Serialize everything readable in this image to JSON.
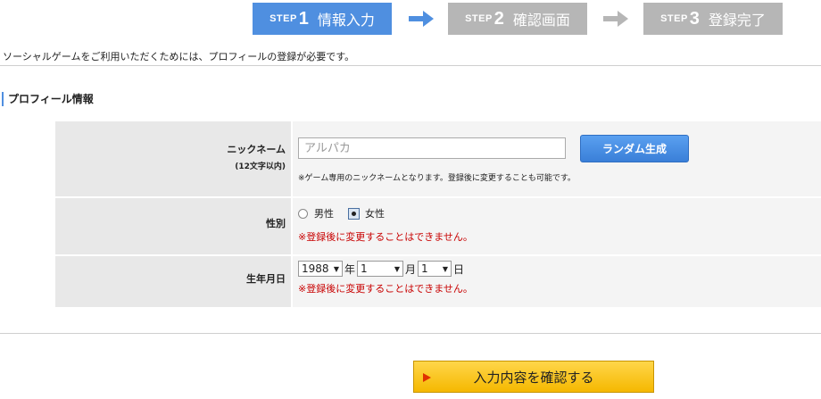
{
  "steps": [
    {
      "label": "STEP",
      "num": "1",
      "name": "情報入力",
      "state": "active"
    },
    {
      "label": "STEP",
      "num": "2",
      "name": "確認画面",
      "state": "inactive"
    },
    {
      "label": "STEP",
      "num": "3",
      "name": "登録完了",
      "state": "inactive"
    }
  ],
  "intro": "ソーシャルゲームをご利用いただくためには、プロフィールの登録が必要です。",
  "section_title": "プロフィール情報",
  "form": {
    "nickname": {
      "label": "ニックネーム",
      "sublabel": "(12文字以内)",
      "placeholder": "アルパカ",
      "value": "",
      "random_button": "ランダム生成",
      "note": "※ゲーム専用のニックネームとなります。登録後に変更することも可能です。"
    },
    "gender": {
      "label": "性別",
      "options": [
        "男性",
        "女性"
      ],
      "selected": "女性",
      "warning": "※登録後に変更することはできません。"
    },
    "birthdate": {
      "label": "生年月日",
      "year": "1988",
      "year_unit": "年",
      "month": "1",
      "month_unit": "月",
      "day": "1",
      "day_unit": "日",
      "warning": "※登録後に変更することはできません。"
    }
  },
  "confirm_button": "入力内容を確認する",
  "colors": {
    "active_step": "#4f8fe0",
    "inactive_step": "#b6b6b6",
    "warning": "#c80000",
    "confirm": "#f5b800"
  }
}
